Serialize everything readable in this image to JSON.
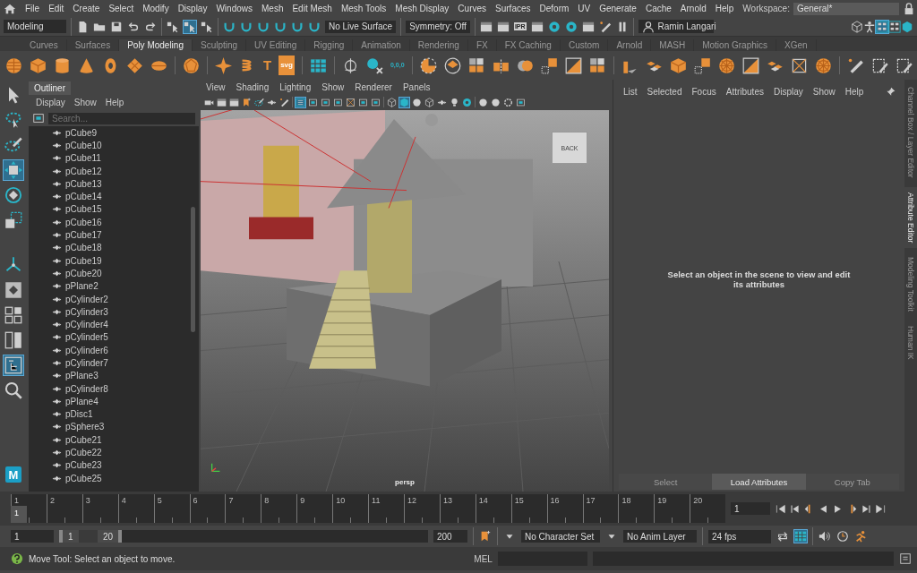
{
  "menu_bar": {
    "items": [
      "File",
      "Edit",
      "Create",
      "Select",
      "Modify",
      "Display",
      "Windows",
      "Mesh",
      "Edit Mesh",
      "Mesh Tools",
      "Mesh Display",
      "Curves",
      "Surfaces",
      "Deform",
      "UV",
      "Generate",
      "Cache",
      "Arnold",
      "Help"
    ],
    "workspace_label": "Workspace:",
    "workspace": "General*"
  },
  "status_line": {
    "mode": "Modeling",
    "live_surface": "No Live Surface",
    "symmetry": "Symmetry: Off",
    "render_label": "IPR",
    "user": "Ramin Langari"
  },
  "shelf": {
    "tabs": [
      {
        "label": "Curves",
        "selected": false
      },
      {
        "label": "Surfaces",
        "selected": false
      },
      {
        "label": "Poly Modeling",
        "selected": true
      },
      {
        "label": "Sculpting",
        "selected": false
      },
      {
        "label": "UV Editing",
        "selected": false
      },
      {
        "label": "Rigging",
        "selected": false
      },
      {
        "label": "Animation",
        "selected": false
      },
      {
        "label": "Rendering",
        "selected": false
      },
      {
        "label": "FX",
        "selected": false
      },
      {
        "label": "FX Caching",
        "selected": false
      },
      {
        "label": "Custom",
        "selected": false
      },
      {
        "label": "Arnold",
        "selected": false
      },
      {
        "label": "MASH",
        "selected": false
      },
      {
        "label": "Motion Graphics",
        "selected": false
      },
      {
        "label": "XGen",
        "selected": false
      }
    ],
    "glyphs": [
      "T",
      "svg",
      "0,0,0"
    ]
  },
  "toolbox": {
    "tools": [
      {
        "selected": false
      },
      {
        "selected": false
      },
      {
        "selected": false
      },
      {
        "selected": true
      },
      {
        "selected": false
      },
      {
        "selected": false
      }
    ],
    "layouts": [
      {
        "selected": false
      },
      {
        "selected": false
      },
      {
        "selected": false
      },
      {
        "selected": true
      }
    ],
    "logo": "M"
  },
  "outliner": {
    "title": "Outliner",
    "menu": [
      "Display",
      "Show",
      "Help"
    ],
    "placeholder": "Search...",
    "items": [
      "pCube9",
      "pCube10",
      "pCube11",
      "pCube12",
      "pCube13",
      "pCube14",
      "pCube15",
      "pCube16",
      "pCube17",
      "pCube18",
      "pCube19",
      "pCube20",
      "pPlane2",
      "pCylinder2",
      "pCylinder3",
      "pCylinder4",
      "pCylinder5",
      "pCylinder6",
      "pCylinder7",
      "pPlane3",
      "pCylinder8",
      "pPlane4",
      "pDisc1",
      "pSphere3",
      "pCube21",
      "pCube22",
      "pCube23",
      "pCube25"
    ]
  },
  "viewport": {
    "menu": [
      "View",
      "Shading",
      "Lighting",
      "Show",
      "Renderer",
      "Panels"
    ],
    "view_cube": "BACK",
    "camera": "persp"
  },
  "attribute_editor": {
    "menu": [
      "List",
      "Selected",
      "Focus",
      "Attributes",
      "Display",
      "Show",
      "Help"
    ],
    "message": "Select an object in the scene to view and edit its attributes",
    "buttons": [
      {
        "label": "Select",
        "disabled": true
      },
      {
        "label": "Load Attributes",
        "disabled": false
      },
      {
        "label": "Copy Tab",
        "disabled": true
      }
    ]
  },
  "side_tabs": [
    {
      "label": "Channel Box / Layer Editor",
      "selected": false
    },
    {
      "label": "Attribute Editor",
      "selected": true
    },
    {
      "label": "Modeling Toolkit",
      "selected": false
    },
    {
      "label": "Human IK",
      "selected": false
    }
  ],
  "timeline": {
    "ticks": [
      "1",
      "2",
      "3",
      "4",
      "5",
      "6",
      "7",
      "8",
      "9",
      "10",
      "11",
      "12",
      "13",
      "14",
      "15",
      "16",
      "17",
      "18",
      "19",
      "20"
    ],
    "current_frame": "1",
    "level": 0,
    "frame_field": "1"
  },
  "range": {
    "start": "1",
    "inner_start": "1",
    "inner_end": "20",
    "level": 0.13,
    "end": "200",
    "character_set": "No Character Set",
    "anim_layer": "No Anim Layer",
    "fps": "24 fps"
  },
  "command_line": {
    "help": "Move Tool: Select an object to move.",
    "language": "MEL"
  }
}
